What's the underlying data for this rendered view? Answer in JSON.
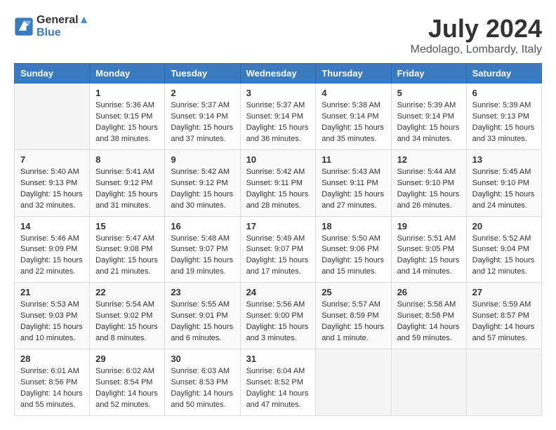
{
  "header": {
    "logo_line1": "General",
    "logo_line2": "Blue",
    "month": "July 2024",
    "location": "Medolago, Lombardy, Italy"
  },
  "days_of_week": [
    "Sunday",
    "Monday",
    "Tuesday",
    "Wednesday",
    "Thursday",
    "Friday",
    "Saturday"
  ],
  "weeks": [
    [
      {
        "day": "",
        "sunrise": "",
        "sunset": "",
        "daylight": ""
      },
      {
        "day": "1",
        "sunrise": "Sunrise: 5:36 AM",
        "sunset": "Sunset: 9:15 PM",
        "daylight": "Daylight: 15 hours and 38 minutes."
      },
      {
        "day": "2",
        "sunrise": "Sunrise: 5:37 AM",
        "sunset": "Sunset: 9:14 PM",
        "daylight": "Daylight: 15 hours and 37 minutes."
      },
      {
        "day": "3",
        "sunrise": "Sunrise: 5:37 AM",
        "sunset": "Sunset: 9:14 PM",
        "daylight": "Daylight: 15 hours and 36 minutes."
      },
      {
        "day": "4",
        "sunrise": "Sunrise: 5:38 AM",
        "sunset": "Sunset: 9:14 PM",
        "daylight": "Daylight: 15 hours and 35 minutes."
      },
      {
        "day": "5",
        "sunrise": "Sunrise: 5:39 AM",
        "sunset": "Sunset: 9:14 PM",
        "daylight": "Daylight: 15 hours and 34 minutes."
      },
      {
        "day": "6",
        "sunrise": "Sunrise: 5:39 AM",
        "sunset": "Sunset: 9:13 PM",
        "daylight": "Daylight: 15 hours and 33 minutes."
      }
    ],
    [
      {
        "day": "7",
        "sunrise": "Sunrise: 5:40 AM",
        "sunset": "Sunset: 9:13 PM",
        "daylight": "Daylight: 15 hours and 32 minutes."
      },
      {
        "day": "8",
        "sunrise": "Sunrise: 5:41 AM",
        "sunset": "Sunset: 9:12 PM",
        "daylight": "Daylight: 15 hours and 31 minutes."
      },
      {
        "day": "9",
        "sunrise": "Sunrise: 5:42 AM",
        "sunset": "Sunset: 9:12 PM",
        "daylight": "Daylight: 15 hours and 30 minutes."
      },
      {
        "day": "10",
        "sunrise": "Sunrise: 5:42 AM",
        "sunset": "Sunset: 9:11 PM",
        "daylight": "Daylight: 15 hours and 28 minutes."
      },
      {
        "day": "11",
        "sunrise": "Sunrise: 5:43 AM",
        "sunset": "Sunset: 9:11 PM",
        "daylight": "Daylight: 15 hours and 27 minutes."
      },
      {
        "day": "12",
        "sunrise": "Sunrise: 5:44 AM",
        "sunset": "Sunset: 9:10 PM",
        "daylight": "Daylight: 15 hours and 26 minutes."
      },
      {
        "day": "13",
        "sunrise": "Sunrise: 5:45 AM",
        "sunset": "Sunset: 9:10 PM",
        "daylight": "Daylight: 15 hours and 24 minutes."
      }
    ],
    [
      {
        "day": "14",
        "sunrise": "Sunrise: 5:46 AM",
        "sunset": "Sunset: 9:09 PM",
        "daylight": "Daylight: 15 hours and 22 minutes."
      },
      {
        "day": "15",
        "sunrise": "Sunrise: 5:47 AM",
        "sunset": "Sunset: 9:08 PM",
        "daylight": "Daylight: 15 hours and 21 minutes."
      },
      {
        "day": "16",
        "sunrise": "Sunrise: 5:48 AM",
        "sunset": "Sunset: 9:07 PM",
        "daylight": "Daylight: 15 hours and 19 minutes."
      },
      {
        "day": "17",
        "sunrise": "Sunrise: 5:49 AM",
        "sunset": "Sunset: 9:07 PM",
        "daylight": "Daylight: 15 hours and 17 minutes."
      },
      {
        "day": "18",
        "sunrise": "Sunrise: 5:50 AM",
        "sunset": "Sunset: 9:06 PM",
        "daylight": "Daylight: 15 hours and 15 minutes."
      },
      {
        "day": "19",
        "sunrise": "Sunrise: 5:51 AM",
        "sunset": "Sunset: 9:05 PM",
        "daylight": "Daylight: 15 hours and 14 minutes."
      },
      {
        "day": "20",
        "sunrise": "Sunrise: 5:52 AM",
        "sunset": "Sunset: 9:04 PM",
        "daylight": "Daylight: 15 hours and 12 minutes."
      }
    ],
    [
      {
        "day": "21",
        "sunrise": "Sunrise: 5:53 AM",
        "sunset": "Sunset: 9:03 PM",
        "daylight": "Daylight: 15 hours and 10 minutes."
      },
      {
        "day": "22",
        "sunrise": "Sunrise: 5:54 AM",
        "sunset": "Sunset: 9:02 PM",
        "daylight": "Daylight: 15 hours and 8 minutes."
      },
      {
        "day": "23",
        "sunrise": "Sunrise: 5:55 AM",
        "sunset": "Sunset: 9:01 PM",
        "daylight": "Daylight: 15 hours and 6 minutes."
      },
      {
        "day": "24",
        "sunrise": "Sunrise: 5:56 AM",
        "sunset": "Sunset: 9:00 PM",
        "daylight": "Daylight: 15 hours and 3 minutes."
      },
      {
        "day": "25",
        "sunrise": "Sunrise: 5:57 AM",
        "sunset": "Sunset: 8:59 PM",
        "daylight": "Daylight: 15 hours and 1 minute."
      },
      {
        "day": "26",
        "sunrise": "Sunrise: 5:58 AM",
        "sunset": "Sunset: 8:58 PM",
        "daylight": "Daylight: 14 hours and 59 minutes."
      },
      {
        "day": "27",
        "sunrise": "Sunrise: 5:59 AM",
        "sunset": "Sunset: 8:57 PM",
        "daylight": "Daylight: 14 hours and 57 minutes."
      }
    ],
    [
      {
        "day": "28",
        "sunrise": "Sunrise: 6:01 AM",
        "sunset": "Sunset: 8:56 PM",
        "daylight": "Daylight: 14 hours and 55 minutes."
      },
      {
        "day": "29",
        "sunrise": "Sunrise: 6:02 AM",
        "sunset": "Sunset: 8:54 PM",
        "daylight": "Daylight: 14 hours and 52 minutes."
      },
      {
        "day": "30",
        "sunrise": "Sunrise: 6:03 AM",
        "sunset": "Sunset: 8:53 PM",
        "daylight": "Daylight: 14 hours and 50 minutes."
      },
      {
        "day": "31",
        "sunrise": "Sunrise: 6:04 AM",
        "sunset": "Sunset: 8:52 PM",
        "daylight": "Daylight: 14 hours and 47 minutes."
      },
      {
        "day": "",
        "sunrise": "",
        "sunset": "",
        "daylight": ""
      },
      {
        "day": "",
        "sunrise": "",
        "sunset": "",
        "daylight": ""
      },
      {
        "day": "",
        "sunrise": "",
        "sunset": "",
        "daylight": ""
      }
    ]
  ]
}
